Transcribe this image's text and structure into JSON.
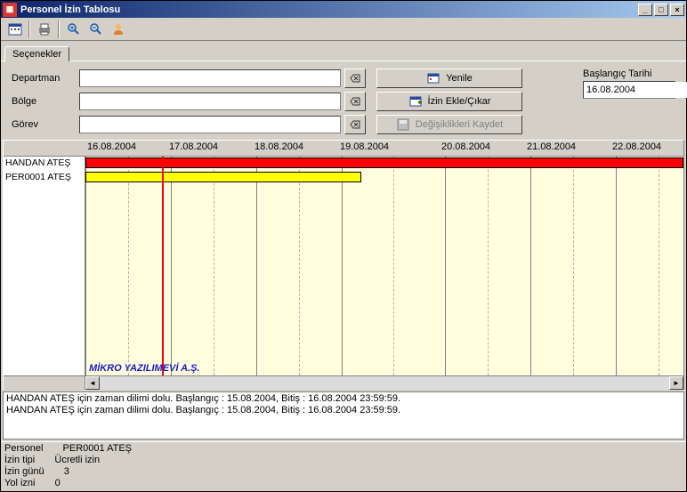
{
  "window": {
    "title": "Personel İzin Tablosu"
  },
  "tabs": [
    {
      "label": "Seçenekler"
    }
  ],
  "filters": {
    "departman_label": "Departman",
    "departman_value": "",
    "bolge_label": "Bölge",
    "bolge_value": "",
    "gorev_label": "Görev",
    "gorev_value": ""
  },
  "actions": {
    "refresh": "Yenile",
    "addremove": "İzin Ekle/Çıkar",
    "save": "Değişiklikleri Kaydet"
  },
  "start_date": {
    "label": "Başlangıç Tarihi",
    "value": "16.08.2004"
  },
  "gantt": {
    "dates": [
      "16.08.2004",
      "17.08.2004",
      "18.08.2004",
      "19.08.2004",
      "20.08.2004",
      "21.08.2004",
      "22.08.2004"
    ],
    "rows": [
      {
        "label": "HANDAN ATEŞ"
      },
      {
        "label": "PER0001 ATEŞ"
      }
    ],
    "watermark": "MİKRO YAZILIMEVİ A.Ş."
  },
  "log": {
    "line1": "HANDAN ATEŞ için zaman dilimi dolu. Başlangıç : 15.08.2004, Bitiş : 16.08.2004 23:59:59.",
    "line2": "HANDAN ATEŞ için zaman dilimi dolu. Başlangıç : 15.08.2004, Bitiş : 16.08.2004 23:59:59."
  },
  "status": {
    "person_label": "Personel",
    "person_value": "PER0001 ATEŞ",
    "type_label": "İzin tipi",
    "type_value": "Ücretli izin",
    "days_label": "İzin günü",
    "days_value": "3",
    "travel_label": "Yol izni",
    "travel_value": "0"
  }
}
